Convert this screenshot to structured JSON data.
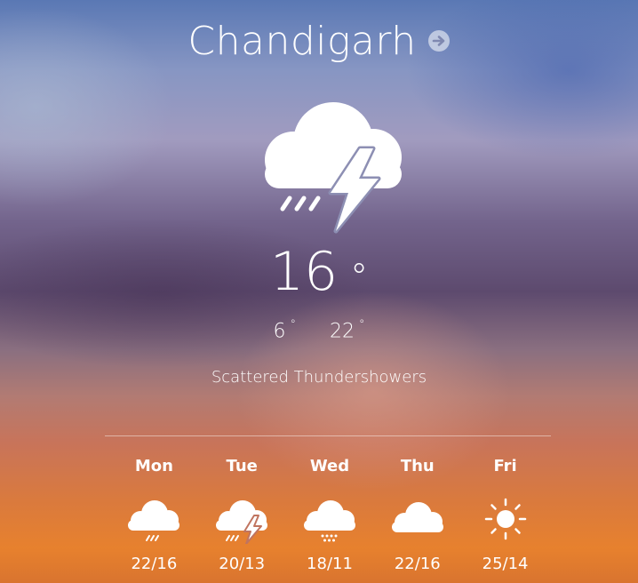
{
  "location": {
    "city": "Chandigarh",
    "nav_icon": "arrow-right-circle-icon"
  },
  "current": {
    "icon": "cloud-rain-thunder-icon",
    "temperature": "16",
    "degree_symbol": "°",
    "low": "6",
    "high": "22",
    "condition": "Scattered Thundershowers"
  },
  "forecast": [
    {
      "day": "Mon",
      "icon": "cloud-rain-icon",
      "range": "22/16"
    },
    {
      "day": "Tue",
      "icon": "cloud-rain-thunder-icon",
      "range": "20/13"
    },
    {
      "day": "Wed",
      "icon": "cloud-snow-icon",
      "range": "18/11"
    },
    {
      "day": "Thu",
      "icon": "cloud-icon",
      "range": "22/16"
    },
    {
      "day": "Fri",
      "icon": "sun-icon",
      "range": "25/14"
    }
  ],
  "colors": {
    "text": "#ffffff",
    "sky_top": "#5a78b4",
    "sky_bottom": "#e7812e"
  }
}
